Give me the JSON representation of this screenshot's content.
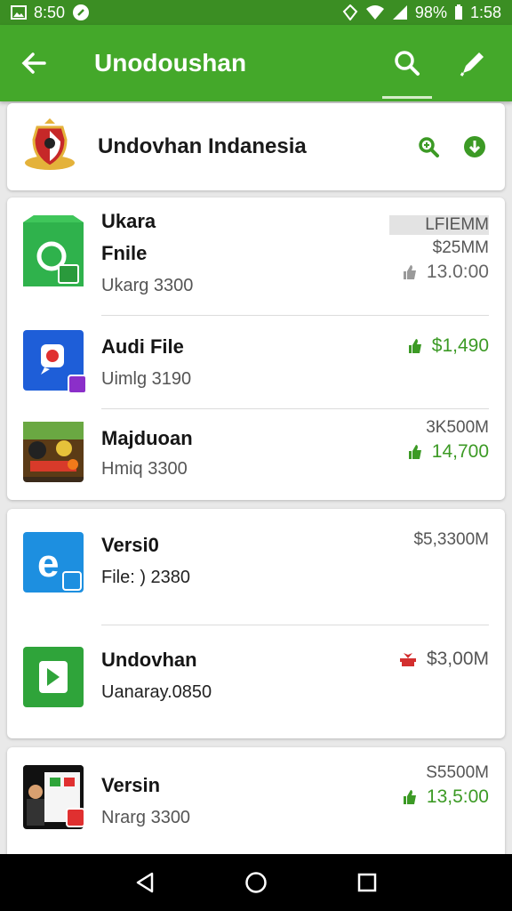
{
  "status_bar": {
    "time_left": "8:50",
    "battery": "98%",
    "clock": "1:58"
  },
  "app_bar": {
    "title": "Unodoushan"
  },
  "header": {
    "title": "Undovhan Indanesia"
  },
  "card1": {
    "top_label": "LFIEMM",
    "rows": [
      {
        "name": "Ukara",
        "name2": "Fnile",
        "sub": "Ukarg 3300",
        "size": "$25MM",
        "price": "13.0:00"
      },
      {
        "name": "Audi File",
        "sub": "Uimlg 3190",
        "price": "$1,490"
      },
      {
        "name": "Majduoan",
        "sub": "Hmiq 3300",
        "size": "3K500M",
        "price": "14,700"
      }
    ]
  },
  "card2": {
    "rows": [
      {
        "name": "Versi0",
        "sub": "File: ) 2380",
        "size": "$5,3300M"
      },
      {
        "name": "Undovhan",
        "sub": "Uanaray.0850",
        "size": "$3,00M"
      }
    ]
  },
  "card3": {
    "rows": [
      {
        "name": "Versin",
        "sub": "Nrarg 3300",
        "size": "S5500M",
        "price": "13,5:00"
      }
    ]
  },
  "colors": {
    "brand_green": "#44a82a",
    "status_green": "#3b8e23",
    "price_green": "#3c9a25",
    "nav": "#000000"
  },
  "icons": [
    "back-arrow-icon",
    "search-icon",
    "edit-pencil-icon",
    "zoom-icon",
    "download-icon",
    "thumb-up-icon",
    "gift-icon",
    "back-nav-icon",
    "home-nav-icon",
    "recents-nav-icon"
  ]
}
